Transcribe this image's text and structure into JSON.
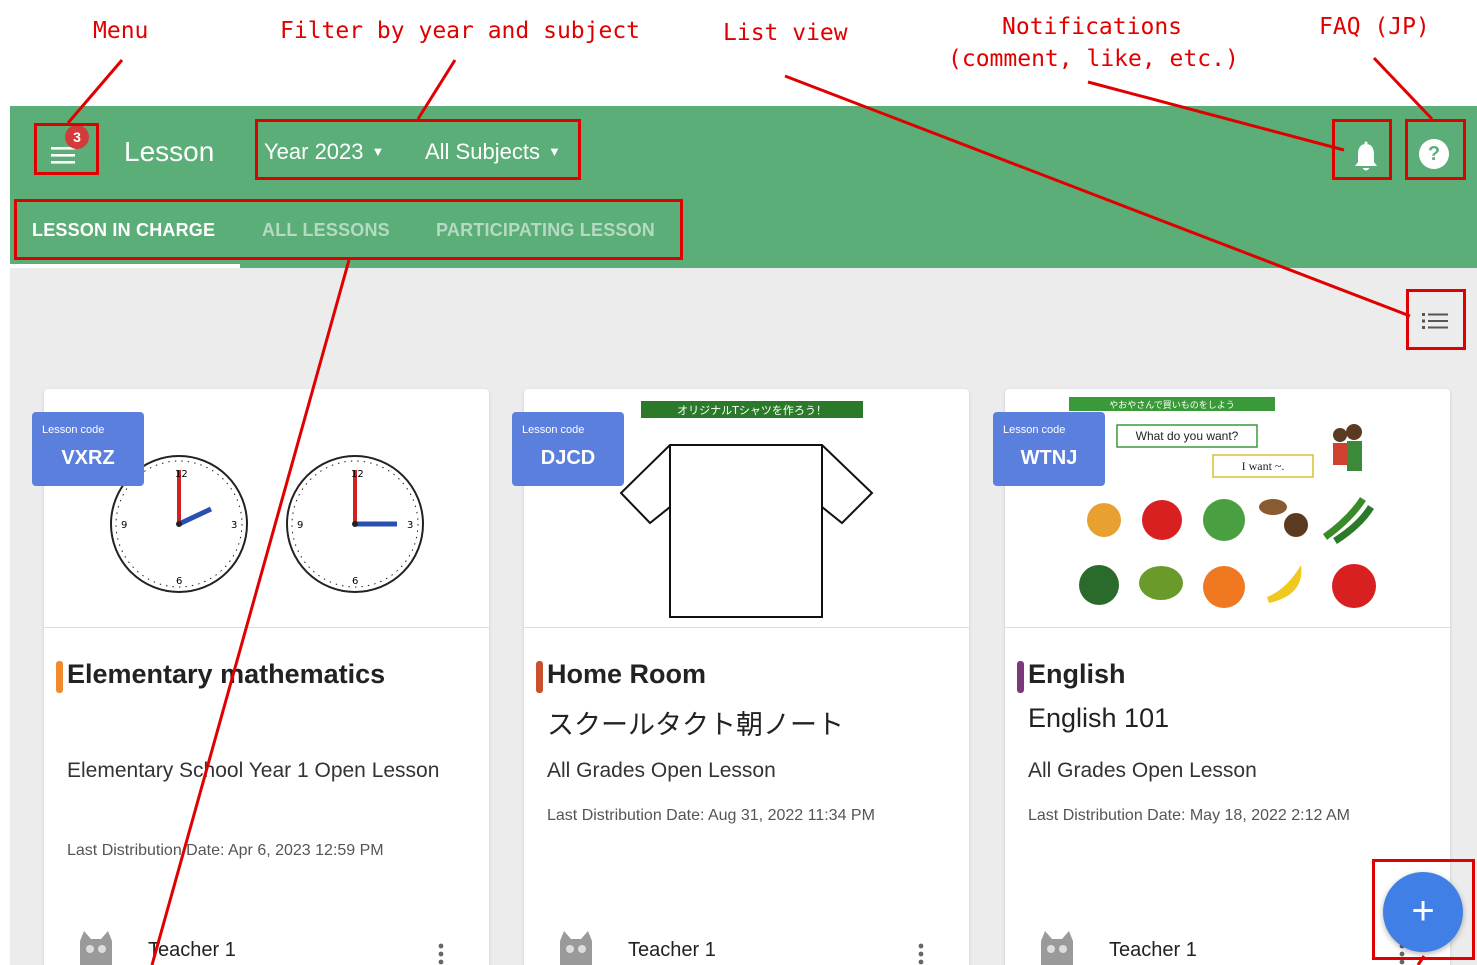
{
  "callouts": {
    "menu": "Menu",
    "filter": "Filter by year and subject",
    "list_view": "List view",
    "notifications_line1": "Notifications",
    "notifications_line2": "(comment, like, etc.)",
    "faq": "FAQ (JP)"
  },
  "header": {
    "title": "Lesson",
    "menu_badge": "3",
    "year_filter": "Year 2023",
    "subject_filter": "All Subjects",
    "help_icon_glyph": "?"
  },
  "tabs": [
    {
      "label": "LESSON IN CHARGE",
      "active": true
    },
    {
      "label": "ALL LESSONS",
      "active": false
    },
    {
      "label": "PARTICIPATING LESSON",
      "active": false
    }
  ],
  "cards": [
    {
      "code_label": "Lesson code",
      "code": "VXRZ",
      "subject": "Elementary mathematics",
      "subject_color": "#f08a2c",
      "lesson_name": "",
      "grade": "Elementary School Year 1 Open Lesson",
      "distribution": "Last Distribution Date: Apr 6, 2023 12:59 PM",
      "teacher": "Teacher 1",
      "image": "clock-faces-illustration"
    },
    {
      "code_label": "Lesson code",
      "code": "DJCD",
      "subject": "Home Room",
      "subject_color": "#c8502c",
      "lesson_name": "スクールタクト朝ノート",
      "grade": "All Grades Open Lesson",
      "distribution": "Last Distribution Date: Aug 31, 2022 11:34 PM",
      "teacher": "Teacher 1",
      "image": "tshirt-template-illustration",
      "image_banner": "オリジナルTシャツを作ろう！"
    },
    {
      "code_label": "Lesson code",
      "code": "WTNJ",
      "subject": "English",
      "subject_color": "#7a3a7a",
      "lesson_name": "English 101",
      "grade": "All Grades Open Lesson",
      "distribution": "Last Distribution Date: May 18, 2022 2:12 AM",
      "teacher": "Teacher 1",
      "image": "fruit-vegetable-shopping-illustration",
      "image_banner": "やおやさんで買いものをしよう",
      "bubble1": "What do you want?",
      "bubble2": "I want ~."
    }
  ],
  "fab": {
    "glyph": "+"
  },
  "colors": {
    "header_green": "#5cae78",
    "code_blue": "#5b7fdc",
    "fab_blue": "#3f7fe6",
    "annotation_red": "#e00000"
  }
}
